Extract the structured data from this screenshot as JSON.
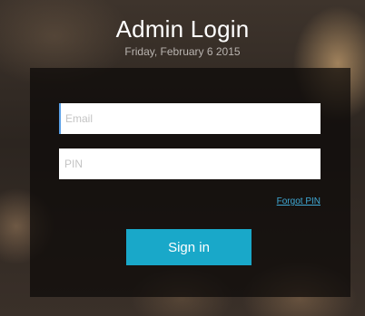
{
  "header": {
    "title": "Admin Login",
    "date": "Friday, February 6 2015"
  },
  "form": {
    "email_placeholder": "Email",
    "email_value": "",
    "pin_placeholder": "PIN",
    "pin_value": "",
    "forgot_label": "Forgot PIN",
    "signin_label": "Sign in"
  },
  "colors": {
    "accent": "#19a8c9",
    "link": "#3fa9d6"
  }
}
